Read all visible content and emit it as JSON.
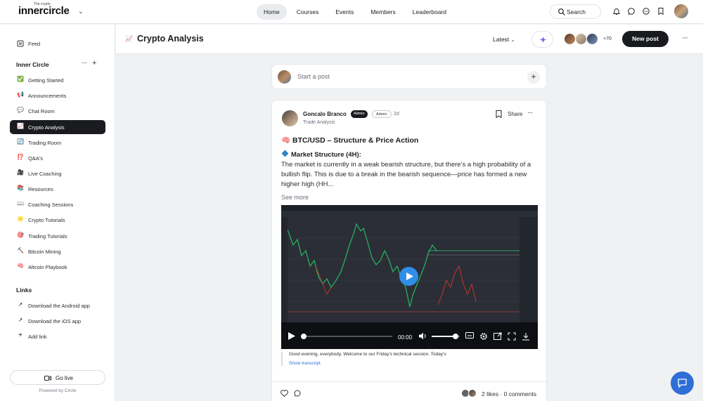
{
  "brand": {
    "name": "innercircle",
    "superscript": "The crypto"
  },
  "nav": {
    "items": [
      {
        "label": "Home",
        "active": true
      },
      {
        "label": "Courses"
      },
      {
        "label": "Events"
      },
      {
        "label": "Members"
      },
      {
        "label": "Leaderboard"
      }
    ]
  },
  "search": {
    "label": "Search"
  },
  "sidebar": {
    "feed": {
      "icon": "feed-icon",
      "label": "Feed"
    },
    "section_title": "Inner Circle",
    "items": [
      {
        "emoji": "✅",
        "label": "Getting Started"
      },
      {
        "emoji": "📢",
        "label": "Announcements"
      },
      {
        "emoji": "💬",
        "label": "Chat Room"
      },
      {
        "emoji": "📈",
        "label": "Crypto Analysis",
        "active": true
      },
      {
        "emoji": "🔄",
        "label": "Trading Room"
      },
      {
        "emoji": "⁉️",
        "label": "Q&A's"
      },
      {
        "emoji": "🎥",
        "label": "Live Coaching"
      },
      {
        "emoji": "📚",
        "label": "Resources"
      },
      {
        "emoji": "📖",
        "label": "Coaching Sessions"
      },
      {
        "emoji": "🌟",
        "label": "Crypto Tutorials"
      },
      {
        "emoji": "🎯",
        "label": "Trading Tutorials"
      },
      {
        "emoji": "⛏️",
        "label": "Bitcoin Mining"
      },
      {
        "emoji": "🧠",
        "label": "Altcoin Playbook"
      }
    ],
    "links_title": "Links",
    "links": [
      {
        "label": "Download the Android app"
      },
      {
        "label": "Download the iOS app"
      },
      {
        "label": "Add link"
      }
    ],
    "go_live": "Go live",
    "powered_by": "Powered by Circle"
  },
  "space": {
    "emoji": "📈",
    "title": "Crypto Analysis",
    "sort": "Latest",
    "member_overflow": "+70",
    "new_post": "New post"
  },
  "composer": {
    "placeholder": "Start a post"
  },
  "post": {
    "author": "Goncalo Branco",
    "badge_primary": "Admin",
    "badge_secondary": "Admin",
    "time": "2d",
    "space": "Trade Analysis",
    "share": "Share",
    "title": "🧠 BTC/USD – Structure & Price Action",
    "section_heading": "Market Structure (4H):",
    "body": "The market is currently in a weak bearish structure, but there’s a high probability of a bullish flip. This is due to a break in the bearish sequence—price has formed a new higher high (HH...",
    "see_more": "See more",
    "video": {
      "time": "00:00",
      "volume": 0.85,
      "progress": 0.0
    },
    "transcript": "Good evening, everybody. Welcome to our Friday's technical session. Today's",
    "show_transcript": "Show transcript",
    "likes": "2 likes",
    "comments": "0 comments"
  },
  "colors": {
    "primary_dark": "#191b1f",
    "accent_blue": "#2e6ed6",
    "play_blue": "#2e8ee8",
    "spark_purple": "#8b5cf6"
  }
}
